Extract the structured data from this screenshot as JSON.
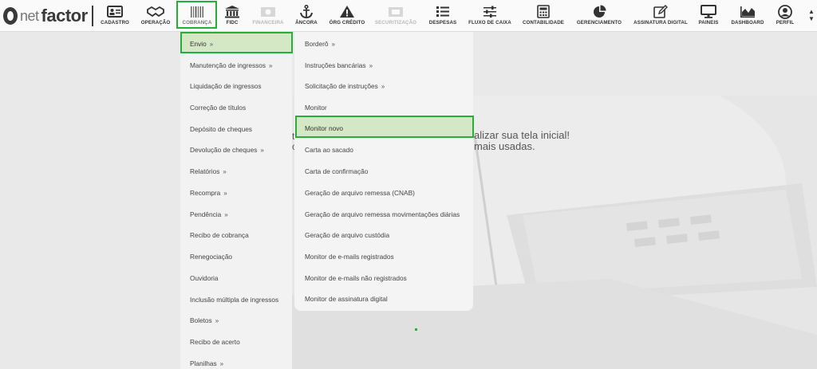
{
  "brand": {
    "o": "O",
    "net": "net",
    "factor": "factor"
  },
  "nav": {
    "items": [
      {
        "id": "cadastro",
        "label": "CADASTRO",
        "icon": "id-card-icon",
        "disabled": false
      },
      {
        "id": "operacao",
        "label": "OPERAÇÃO",
        "icon": "handshake-icon",
        "disabled": false
      },
      {
        "id": "cobranca",
        "label": "COBRANÇA",
        "icon": "barcode-icon",
        "disabled": false,
        "active": true
      },
      {
        "id": "fidc",
        "label": "FIDC",
        "icon": "bank-icon",
        "disabled": false
      },
      {
        "id": "financeira",
        "label": "FINANCEIRA",
        "icon": "money-icon",
        "disabled": true
      },
      {
        "id": "ancora",
        "label": "ÂNCORA",
        "icon": "anchor-icon",
        "disabled": false
      },
      {
        "id": "org_credito",
        "label": "ÓRG CRÉDITO",
        "icon": "warning-icon",
        "disabled": false
      },
      {
        "id": "securitizacao",
        "label": "SECURITIZAÇÃO",
        "icon": "layers-icon",
        "disabled": true
      },
      {
        "id": "despesas",
        "label": "DESPESAS",
        "icon": "list-icon",
        "disabled": false
      },
      {
        "id": "fluxo_caixa",
        "label": "FLUXO DE CAIXA",
        "icon": "sliders-icon",
        "disabled": false
      },
      {
        "id": "contabilidade",
        "label": "CONTABILIDADE",
        "icon": "calculator-icon",
        "disabled": false
      },
      {
        "id": "gerenciamento",
        "label": "GERENCIAMENTO",
        "icon": "pie-chart-icon",
        "disabled": false
      },
      {
        "id": "assinatura",
        "label": "ASSINATURA DIGITAL",
        "icon": "pen-icon",
        "disabled": false
      },
      {
        "id": "paineis",
        "label": "PAINEIS",
        "icon": "monitor-icon",
        "disabled": false
      },
      {
        "id": "dashboard",
        "label": "DASHBOARD",
        "icon": "area-chart-icon",
        "disabled": false
      },
      {
        "id": "perfil",
        "label": "PERFIL",
        "icon": "user-icon",
        "disabled": false
      }
    ]
  },
  "menu_cobranca": {
    "items": [
      {
        "label": "Envio",
        "chevron": "»",
        "selected": true
      },
      {
        "label": "Manutenção de ingressos",
        "chevron": "»"
      },
      {
        "label": "Liquidação de ingressos"
      },
      {
        "label": "Correção de títulos"
      },
      {
        "label": "Depósito de cheques"
      },
      {
        "label": "Devolução de cheques",
        "chevron": "»"
      },
      {
        "label": "Relatórios",
        "chevron": "»"
      },
      {
        "label": "Recompra",
        "chevron": "»"
      },
      {
        "label": "Pendência",
        "chevron": "»"
      },
      {
        "label": "Recibo de cobrança"
      },
      {
        "label": "Renegociação"
      },
      {
        "label": "Ouvidoria"
      },
      {
        "label": "Inclusão múltipla de ingressos"
      },
      {
        "label": "Boletos",
        "chevron": "»"
      },
      {
        "label": "Recibo de acerto"
      },
      {
        "label": "Planilhas",
        "chevron": "»"
      }
    ]
  },
  "menu_envio": {
    "items": [
      {
        "label": "Borderô",
        "chevron": "»"
      },
      {
        "label": "Instruções bancárias",
        "chevron": "»"
      },
      {
        "label": "Solicitação de instruções",
        "chevron": "»"
      },
      {
        "label": "Monitor"
      },
      {
        "label": "Monitor novo",
        "selected": true
      },
      {
        "label": "Carta ao sacado"
      },
      {
        "label": "Carta de confirmação"
      },
      {
        "label": "Geração de arquivo remessa (CNAB)"
      },
      {
        "label": "Geração de arquivo remessa movimentações diárias"
      },
      {
        "label": "Geração de arquivo custódia"
      },
      {
        "label": "Monitor de e-mails registrados"
      },
      {
        "label": "Monitor de e-mails não registrados"
      },
      {
        "label": "Monitor de assinatura digital"
      }
    ]
  },
  "welcome": {
    "line1": "alizar sua tela inicial!",
    "line2": "mais usadas.",
    "frag1": "t",
    "frag2": "c"
  },
  "scroll": {
    "up": "▲",
    "down": "▼"
  }
}
